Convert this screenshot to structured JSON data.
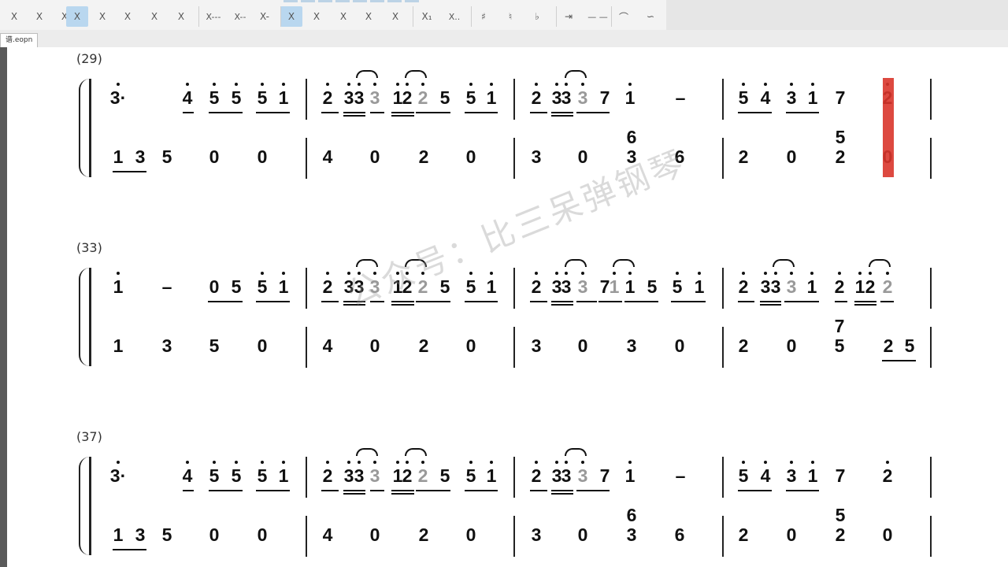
{
  "toolbar": {
    "buttons": [
      "X",
      "X",
      "X",
      "X",
      "X",
      "X",
      "X",
      "X",
      "X---",
      "X--",
      "X-",
      "X",
      "X",
      "X",
      "X",
      "X",
      "X₁",
      "X..",
      "♯",
      "♮",
      "♭",
      "⇥",
      "— —",
      "⌒",
      "∽"
    ]
  },
  "file_tab": {
    "label": "谱.eopn"
  },
  "watermark": "公众号：比三呆弹钢琴",
  "cursor_color": "#d9352b",
  "systems": [
    {
      "number": "(29)",
      "upper": [
        [
          "3·",
          "4",
          "5",
          "5",
          "5",
          "1"
        ],
        [
          "2",
          "3",
          "3",
          "3",
          "1",
          "2",
          "2",
          "5",
          "5",
          "1"
        ],
        [
          "2",
          "3",
          "3",
          "3",
          "7",
          "1",
          "–"
        ],
        [
          "5",
          "4",
          "3",
          "1",
          "7",
          "2"
        ]
      ],
      "lower": [
        [
          "1",
          "3",
          "5",
          "0",
          "0"
        ],
        [
          "4",
          "0",
          "2",
          "0"
        ],
        [
          "3",
          "0",
          "6",
          "3",
          "6"
        ],
        [
          "2",
          "0",
          "5",
          "2",
          "0"
        ]
      ]
    },
    {
      "number": "(33)",
      "upper": [
        [
          "1",
          "–",
          "0",
          "5",
          "5",
          "1"
        ],
        [
          "2",
          "3",
          "3",
          "3",
          "1",
          "2",
          "2",
          "5",
          "5",
          "1"
        ],
        [
          "2",
          "3",
          "3",
          "3",
          "7",
          "1",
          "1",
          "5",
          "5",
          "1"
        ],
        [
          "2",
          "3",
          "3",
          "3",
          "1",
          "2",
          "1",
          "2",
          "2"
        ]
      ],
      "lower": [
        [
          "1",
          "3",
          "5",
          "0"
        ],
        [
          "4",
          "0",
          "2",
          "0"
        ],
        [
          "3",
          "0",
          "3",
          "0"
        ],
        [
          "2",
          "0",
          "7",
          "5",
          "2",
          "5"
        ]
      ]
    },
    {
      "number": "(37)",
      "upper": [
        [
          "3·",
          "4",
          "5",
          "5",
          "5",
          "1"
        ],
        [
          "2",
          "3",
          "3",
          "3",
          "1",
          "2",
          "2",
          "5",
          "5",
          "1"
        ],
        [
          "2",
          "3",
          "3",
          "3",
          "7",
          "1",
          "–"
        ],
        [
          "5",
          "4",
          "3",
          "1",
          "7",
          "2"
        ]
      ],
      "lower": [
        [
          "1",
          "3",
          "5",
          "0",
          "0"
        ],
        [
          "4",
          "0",
          "2",
          "0"
        ],
        [
          "3",
          "0",
          "6",
          "3",
          "6"
        ],
        [
          "2",
          "0",
          "5",
          "2",
          "0"
        ]
      ]
    }
  ]
}
